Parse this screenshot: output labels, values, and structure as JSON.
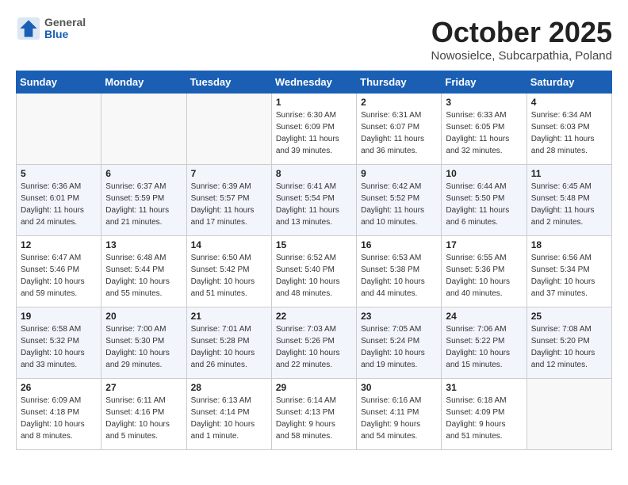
{
  "header": {
    "logo_general": "General",
    "logo_blue": "Blue",
    "title": "October 2025",
    "subtitle": "Nowosielce, Subcarpathia, Poland"
  },
  "days_of_week": [
    "Sunday",
    "Monday",
    "Tuesday",
    "Wednesday",
    "Thursday",
    "Friday",
    "Saturday"
  ],
  "weeks": [
    [
      {
        "day": "",
        "info": ""
      },
      {
        "day": "",
        "info": ""
      },
      {
        "day": "",
        "info": ""
      },
      {
        "day": "1",
        "info": "Sunrise: 6:30 AM\nSunset: 6:09 PM\nDaylight: 11 hours\nand 39 minutes."
      },
      {
        "day": "2",
        "info": "Sunrise: 6:31 AM\nSunset: 6:07 PM\nDaylight: 11 hours\nand 36 minutes."
      },
      {
        "day": "3",
        "info": "Sunrise: 6:33 AM\nSunset: 6:05 PM\nDaylight: 11 hours\nand 32 minutes."
      },
      {
        "day": "4",
        "info": "Sunrise: 6:34 AM\nSunset: 6:03 PM\nDaylight: 11 hours\nand 28 minutes."
      }
    ],
    [
      {
        "day": "5",
        "info": "Sunrise: 6:36 AM\nSunset: 6:01 PM\nDaylight: 11 hours\nand 24 minutes."
      },
      {
        "day": "6",
        "info": "Sunrise: 6:37 AM\nSunset: 5:59 PM\nDaylight: 11 hours\nand 21 minutes."
      },
      {
        "day": "7",
        "info": "Sunrise: 6:39 AM\nSunset: 5:57 PM\nDaylight: 11 hours\nand 17 minutes."
      },
      {
        "day": "8",
        "info": "Sunrise: 6:41 AM\nSunset: 5:54 PM\nDaylight: 11 hours\nand 13 minutes."
      },
      {
        "day": "9",
        "info": "Sunrise: 6:42 AM\nSunset: 5:52 PM\nDaylight: 11 hours\nand 10 minutes."
      },
      {
        "day": "10",
        "info": "Sunrise: 6:44 AM\nSunset: 5:50 PM\nDaylight: 11 hours\nand 6 minutes."
      },
      {
        "day": "11",
        "info": "Sunrise: 6:45 AM\nSunset: 5:48 PM\nDaylight: 11 hours\nand 2 minutes."
      }
    ],
    [
      {
        "day": "12",
        "info": "Sunrise: 6:47 AM\nSunset: 5:46 PM\nDaylight: 10 hours\nand 59 minutes."
      },
      {
        "day": "13",
        "info": "Sunrise: 6:48 AM\nSunset: 5:44 PM\nDaylight: 10 hours\nand 55 minutes."
      },
      {
        "day": "14",
        "info": "Sunrise: 6:50 AM\nSunset: 5:42 PM\nDaylight: 10 hours\nand 51 minutes."
      },
      {
        "day": "15",
        "info": "Sunrise: 6:52 AM\nSunset: 5:40 PM\nDaylight: 10 hours\nand 48 minutes."
      },
      {
        "day": "16",
        "info": "Sunrise: 6:53 AM\nSunset: 5:38 PM\nDaylight: 10 hours\nand 44 minutes."
      },
      {
        "day": "17",
        "info": "Sunrise: 6:55 AM\nSunset: 5:36 PM\nDaylight: 10 hours\nand 40 minutes."
      },
      {
        "day": "18",
        "info": "Sunrise: 6:56 AM\nSunset: 5:34 PM\nDaylight: 10 hours\nand 37 minutes."
      }
    ],
    [
      {
        "day": "19",
        "info": "Sunrise: 6:58 AM\nSunset: 5:32 PM\nDaylight: 10 hours\nand 33 minutes."
      },
      {
        "day": "20",
        "info": "Sunrise: 7:00 AM\nSunset: 5:30 PM\nDaylight: 10 hours\nand 29 minutes."
      },
      {
        "day": "21",
        "info": "Sunrise: 7:01 AM\nSunset: 5:28 PM\nDaylight: 10 hours\nand 26 minutes."
      },
      {
        "day": "22",
        "info": "Sunrise: 7:03 AM\nSunset: 5:26 PM\nDaylight: 10 hours\nand 22 minutes."
      },
      {
        "day": "23",
        "info": "Sunrise: 7:05 AM\nSunset: 5:24 PM\nDaylight: 10 hours\nand 19 minutes."
      },
      {
        "day": "24",
        "info": "Sunrise: 7:06 AM\nSunset: 5:22 PM\nDaylight: 10 hours\nand 15 minutes."
      },
      {
        "day": "25",
        "info": "Sunrise: 7:08 AM\nSunset: 5:20 PM\nDaylight: 10 hours\nand 12 minutes."
      }
    ],
    [
      {
        "day": "26",
        "info": "Sunrise: 6:09 AM\nSunset: 4:18 PM\nDaylight: 10 hours\nand 8 minutes."
      },
      {
        "day": "27",
        "info": "Sunrise: 6:11 AM\nSunset: 4:16 PM\nDaylight: 10 hours\nand 5 minutes."
      },
      {
        "day": "28",
        "info": "Sunrise: 6:13 AM\nSunset: 4:14 PM\nDaylight: 10 hours\nand 1 minute."
      },
      {
        "day": "29",
        "info": "Sunrise: 6:14 AM\nSunset: 4:13 PM\nDaylight: 9 hours\nand 58 minutes."
      },
      {
        "day": "30",
        "info": "Sunrise: 6:16 AM\nSunset: 4:11 PM\nDaylight: 9 hours\nand 54 minutes."
      },
      {
        "day": "31",
        "info": "Sunrise: 6:18 AM\nSunset: 4:09 PM\nDaylight: 9 hours\nand 51 minutes."
      },
      {
        "day": "",
        "info": ""
      }
    ]
  ]
}
